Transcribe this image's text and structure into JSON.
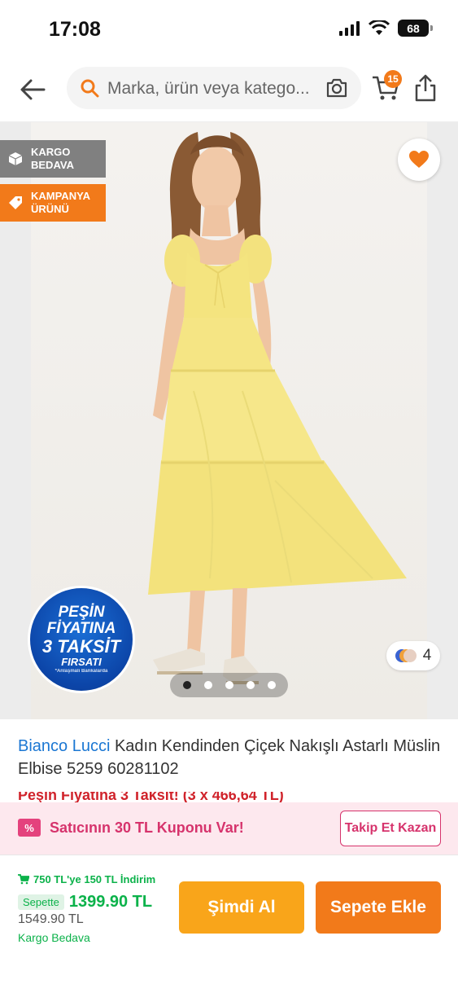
{
  "status": {
    "time": "17:08",
    "battery": "68"
  },
  "header": {
    "search_placeholder": "Marka, ürün veya katego...",
    "cart_count": "15"
  },
  "gallery": {
    "badges": {
      "cargo_line1": "KARGO",
      "cargo_line2": "BEDAVA",
      "campaign_line1": "KAMPANYA",
      "campaign_line2": "ÜRÜNÜ"
    },
    "promo": {
      "line1": "PEŞİN",
      "line2": "FİYATINA",
      "line3": "3 TAKSİT",
      "line4": "FIRSATI",
      "fine_print": "*Anlaşmalı Bankalarda"
    },
    "color_count": "4",
    "page_count": 5,
    "active_page": 0,
    "colors": {
      "accent": "#f27a1a",
      "favorite": "#f27a1a"
    }
  },
  "product": {
    "brand": "Bianco Lucci",
    "name": " Kadın Kendinden Çiçek Nakışlı Astarlı Müslin Elbise 5259 60281102",
    "partial_line": "Peşin Fiyatına 3 Taksit! (3 x 466,64 TL)"
  },
  "coupon": {
    "icon_label": "%",
    "text": "Satıcının 30 TL Kuponu Var!",
    "follow_label": "Takip Et Kazan"
  },
  "bottom": {
    "discount_text": "750 TL'ye 150 TL İndirim",
    "basket_tag": "Sepette",
    "sale_price": "1399.90 TL",
    "old_price": "1549.90 TL",
    "free_cargo": "Kargo Bedava",
    "buy_now_label": "Şimdi Al",
    "add_cart_label": "Sepete Ekle"
  }
}
